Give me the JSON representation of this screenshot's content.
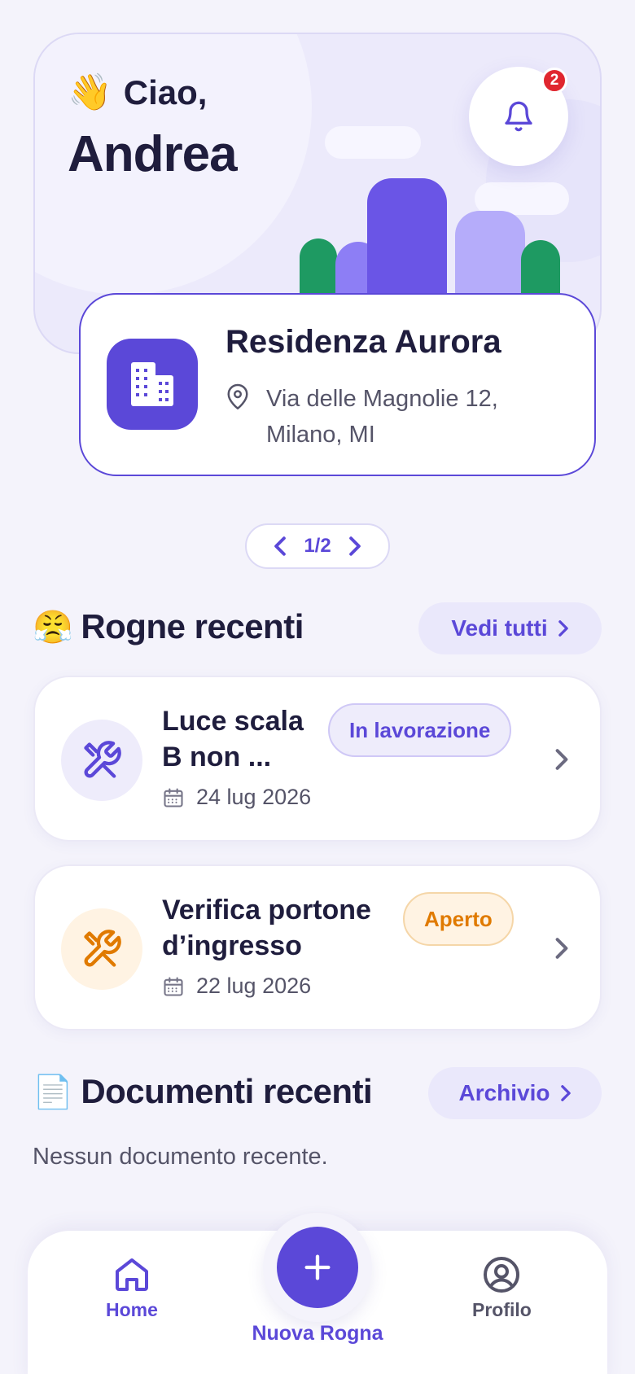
{
  "header": {
    "greeting_emoji": "👋",
    "greeting": "Ciao,",
    "user_name": "Andrea",
    "notifications_count": "2"
  },
  "building": {
    "name": "Residenza Aurora",
    "address": "Via delle Magnolie 12, Milano, MI"
  },
  "pager": {
    "label": "1/2"
  },
  "issues_section": {
    "emoji": "😤",
    "title": "Rogne recenti",
    "see_all_label": "Vedi tutti",
    "items": [
      {
        "title": "Luce scala B non ...",
        "status": "In lavorazione",
        "date": "24 lug 2026",
        "status_color": "#5b48d8",
        "icon": "tools-icon"
      },
      {
        "title": "Verifica portone d’ingresso",
        "status": "Aperto",
        "date": "22 lug 2026",
        "status_color": "#e07a00",
        "icon": "tools-icon"
      }
    ]
  },
  "documents_section": {
    "emoji": "📄",
    "title": "Documenti recenti",
    "archive_label": "Archivio",
    "empty_text": "Nessun documento recente."
  },
  "nav": {
    "home_label": "Home",
    "new_label": "Nuova Rogna",
    "profile_label": "Profilo"
  },
  "colors": {
    "accent": "#5b48d8",
    "background": "#f4f3fb",
    "green": "#1e9a62",
    "warning": "#e07a00"
  }
}
